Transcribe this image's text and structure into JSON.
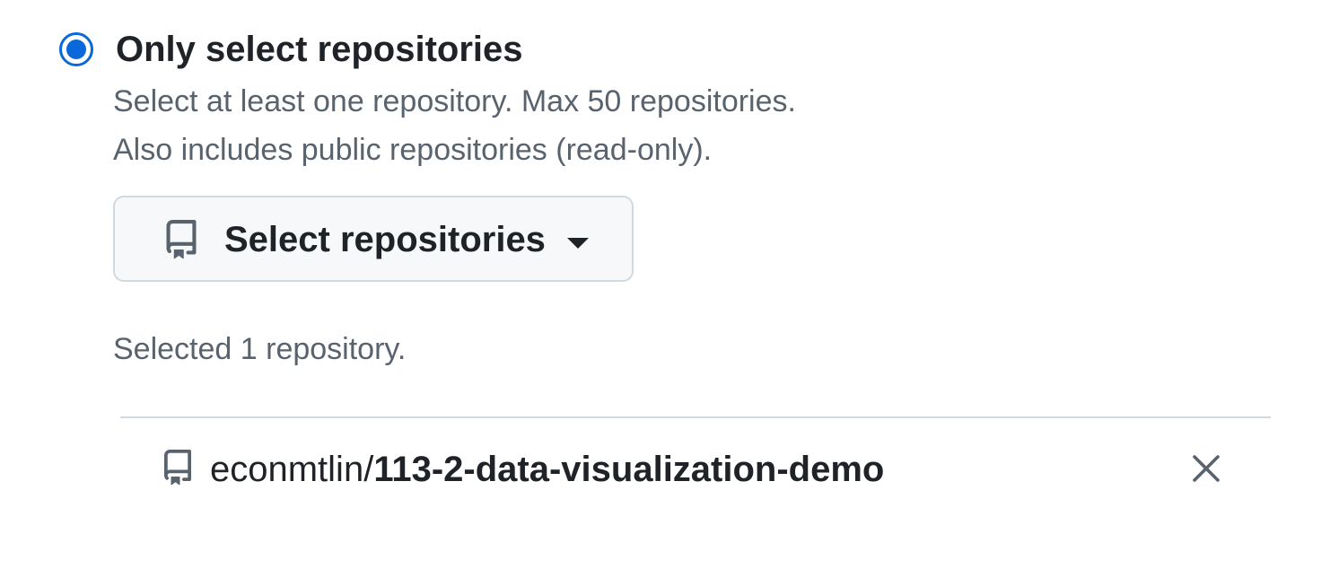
{
  "option": {
    "title": "Only select repositories",
    "selected": true,
    "description_line1": "Select at least one repository. Max 50 repositories.",
    "description_line2": "Also includes public repositories (read-only)."
  },
  "select_button": {
    "label": "Select repositories",
    "icon": "repo-icon",
    "dropdown_icon": "caret-down-icon"
  },
  "selected_count_text": "Selected 1 repository.",
  "selected_repositories": [
    {
      "owner": "econmtlin/",
      "name": "113-2-data-visualization-demo",
      "icon": "repo-icon",
      "remove_icon": "close-icon"
    }
  ],
  "colors": {
    "accent": "#0969da",
    "text_primary": "#1f2328",
    "text_muted": "#59636e",
    "border": "#d1d9e0",
    "button_bg": "#f6f8fa"
  }
}
